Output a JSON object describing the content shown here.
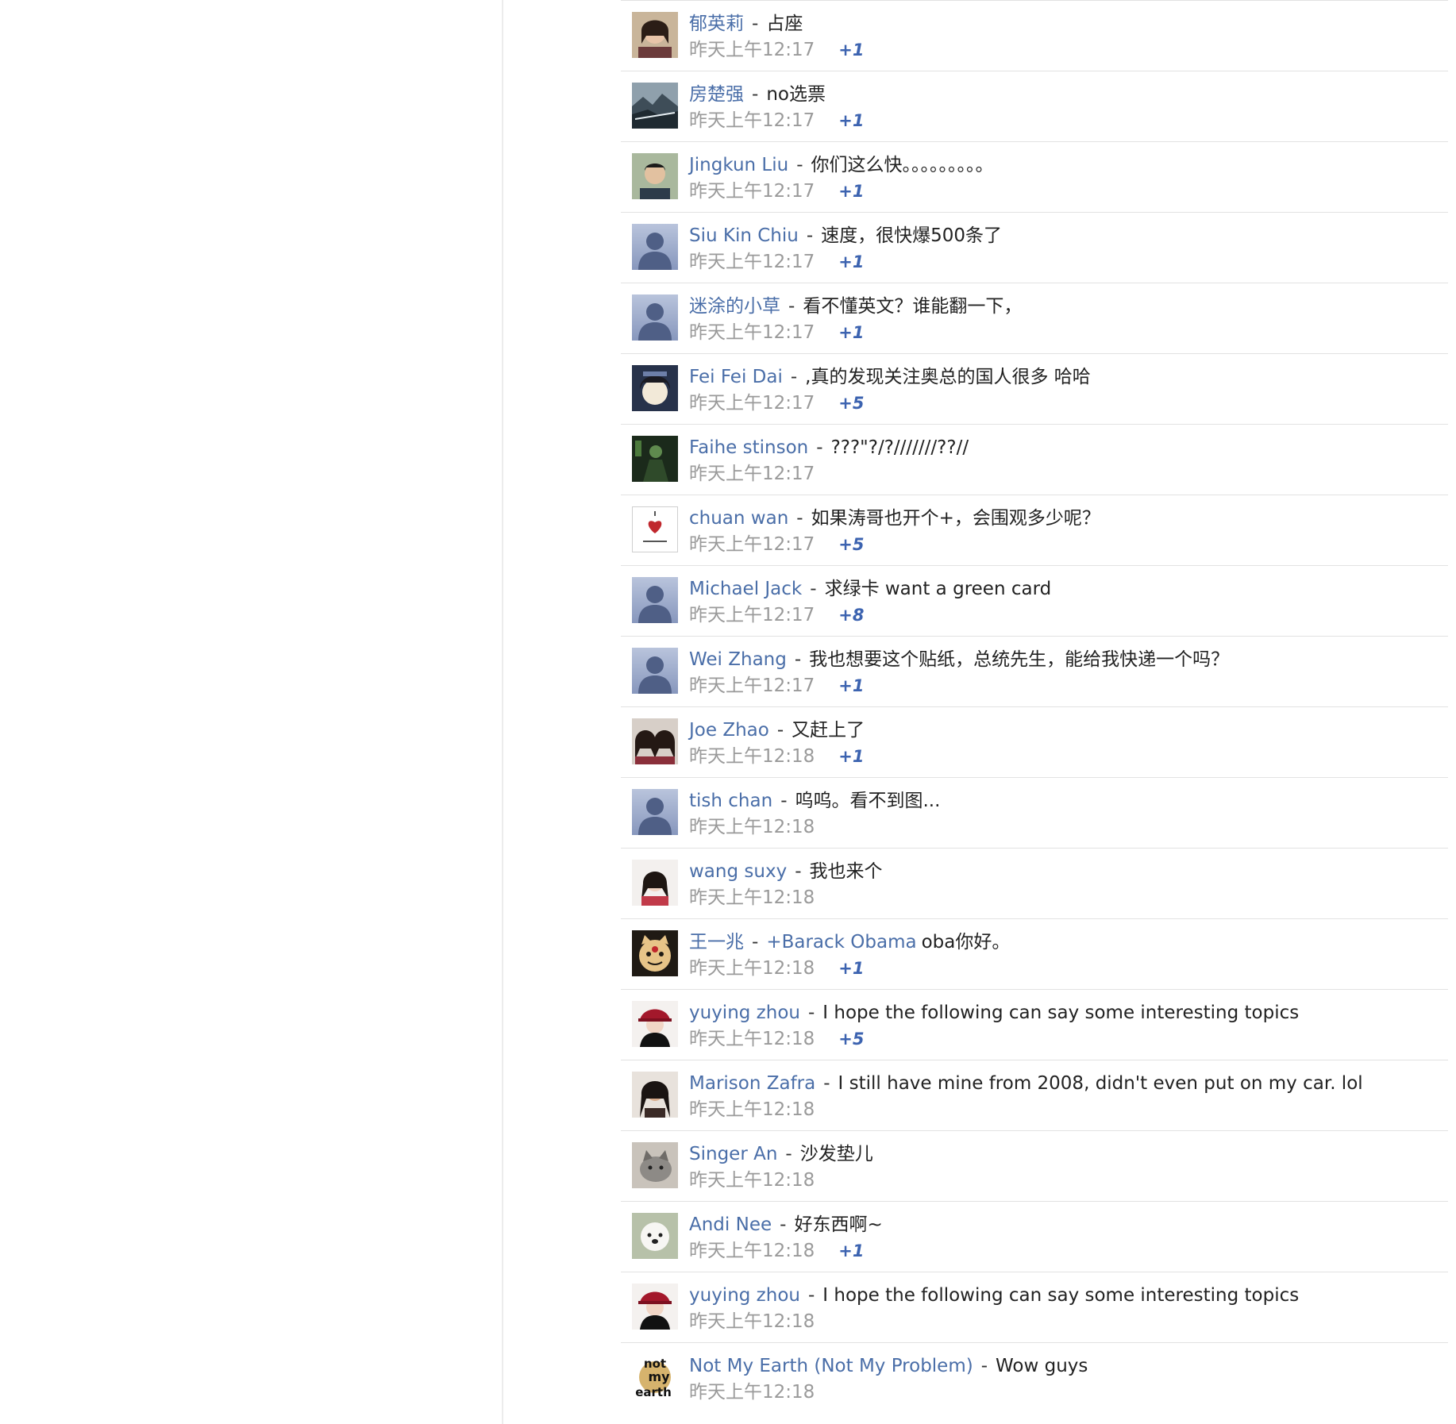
{
  "comments": [
    {
      "author": "郁英莉",
      "text": "占座",
      "time": "昨天上午12:17",
      "plus": "+1",
      "avatar": "photo-woman"
    },
    {
      "author": "房楚强",
      "text": "no选票",
      "time": "昨天上午12:17",
      "plus": "+1",
      "avatar": "photo-landscape"
    },
    {
      "author": "Jingkun Liu",
      "text": "你们这么快。。。。。。。。。",
      "time": "昨天上午12:17",
      "plus": "+1",
      "avatar": "photo-man"
    },
    {
      "author": "Siu Kin Chiu",
      "text": "速度，很快爆500条了",
      "time": "昨天上午12:17",
      "plus": "+1",
      "avatar": "default-silhouette"
    },
    {
      "author": "迷涂的小草",
      "text": "看不懂英文？谁能翻一下，",
      "time": "昨天上午12:17",
      "plus": "+1",
      "avatar": "default-silhouette"
    },
    {
      "author": "Fei Fei Dai",
      "text": ",真的发现关注奥总的国人很多 哈哈",
      "time": "昨天上午12:17",
      "plus": "+5",
      "avatar": "photo-illustration"
    },
    {
      "author": "Faihe stinson",
      "text": "???\"?/?///////??//",
      "time": "昨天上午12:17",
      "plus": "",
      "avatar": "photo-dark-green"
    },
    {
      "author": "chuan wan",
      "text": "如果涛哥也开个+，会围观多少呢？",
      "time": "昨天上午12:17",
      "plus": "+5",
      "avatar": "heart-sketch"
    },
    {
      "author": "Michael Jack",
      "text": "求绿卡 want a green card",
      "time": "昨天上午12:17",
      "plus": "+8",
      "avatar": "default-silhouette"
    },
    {
      "author": "Wei Zhang",
      "text": "我也想要这个贴纸，总统先生，能给我快递一个吗？",
      "time": "昨天上午12:17",
      "plus": "+1",
      "avatar": "default-silhouette"
    },
    {
      "author": "Joe Zhao",
      "text": "又赶上了",
      "time": "昨天上午12:18",
      "plus": "+1",
      "avatar": "photo-two-women"
    },
    {
      "author": "tish chan",
      "text": "呜呜。看不到图...",
      "time": "昨天上午12:18",
      "plus": "",
      "avatar": "default-silhouette"
    },
    {
      "author": "wang suxy",
      "text": "我也来个",
      "time": "昨天上午12:18",
      "plus": "",
      "avatar": "photo-woman-light"
    },
    {
      "author": "王一兆",
      "mention": "+Barack Obama",
      "text": "oba你好。",
      "time": "昨天上午12:18",
      "plus": "+1",
      "avatar": "photo-cartoon-cat"
    },
    {
      "author": "yuying zhou",
      "text": "I hope the following can say some interesting topics",
      "time": "昨天上午12:18",
      "plus": "+5",
      "avatar": "photo-woman-red-hat"
    },
    {
      "author": "Marison Zafra",
      "text": "I still have mine from 2008, didn't even put on my car. lol",
      "time": "昨天上午12:18",
      "plus": "",
      "avatar": "photo-woman-dark"
    },
    {
      "author": "Singer An",
      "text": "沙发垫儿",
      "time": "昨天上午12:18",
      "plus": "",
      "avatar": "photo-cat"
    },
    {
      "author": "Andi Nee",
      "text": "好东西啊~",
      "time": "昨天上午12:18",
      "plus": "+1",
      "avatar": "photo-dog"
    },
    {
      "author": "yuying zhou",
      "text": "I hope the following can say some interesting topics",
      "time": "昨天上午12:18",
      "plus": "",
      "avatar": "photo-woman-red-hat"
    },
    {
      "author": "Not My Earth (Not My Problem)",
      "text": "Wow guys",
      "time": "昨天上午12:18",
      "plus": "",
      "avatar": "logo-not-my-earth",
      "avatar_text": [
        "not",
        "my",
        "earth"
      ]
    }
  ],
  "colors": {
    "author": "#4a6ea8",
    "timestamp": "#9a9a9a",
    "plus": "#3c63b0",
    "divider": "#e2e2e2",
    "default_avatar": "#9aa9c8"
  }
}
